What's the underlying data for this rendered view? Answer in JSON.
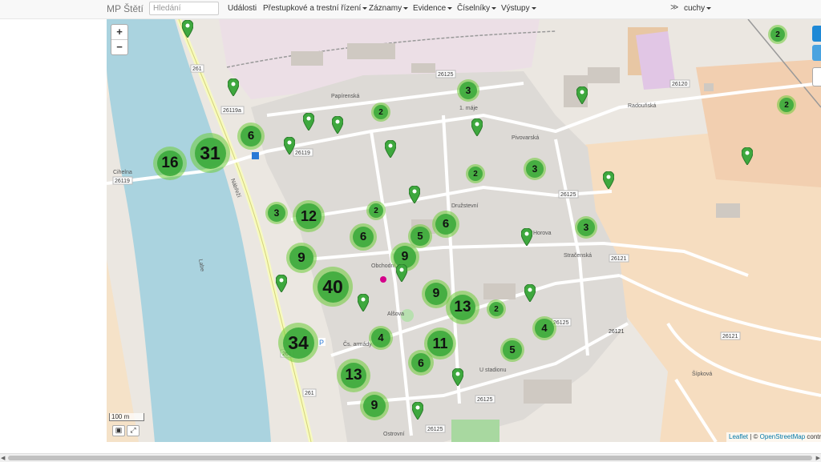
{
  "navbar": {
    "brand": "MP Štětí",
    "search_placeholder": "Hledání",
    "items": [
      {
        "label": "Události",
        "dropdown": false
      },
      {
        "label": "Přestupkové a trestní řízení",
        "dropdown": true
      },
      {
        "label": "Záznamy",
        "dropdown": true
      },
      {
        "label": "Evidence",
        "dropdown": true
      },
      {
        "label": "Číselníky",
        "dropdown": true
      },
      {
        "label": "Výstupy",
        "dropdown": true
      }
    ],
    "collapse_icon": "double-chevron-down-icon",
    "user": "cuchy"
  },
  "map": {
    "zoom_in": "+",
    "zoom_out": "−",
    "scale_label": "100 m",
    "attribution_leaflet": "Leaflet",
    "attribution_sep": " | © ",
    "attribution_osm": "OpenStreetMap",
    "attribution_tail": " contrib",
    "clusters": [
      "16",
      "31",
      "6",
      "2",
      "3",
      "2",
      "3",
      "12",
      "3",
      "2",
      "6",
      "6",
      "5",
      "9",
      "9",
      "40",
      "9",
      "13",
      "3",
      "2",
      "34",
      "4",
      "11",
      "13",
      "6",
      "5",
      "4",
      "9",
      "2",
      "2"
    ],
    "street_labels": [
      "Papírenská",
      "Cihelna",
      "1. máje",
      "Pivovarská",
      "Nábřeží",
      "Horova",
      "Družstevní",
      "Stračenská",
      "Obchodní",
      "Alšova",
      "Čs. armády",
      "Ostrovní",
      "U stadionu",
      "Radouňská",
      "Šípková",
      "Labe"
    ],
    "road_numbers": [
      "261",
      "261",
      "261",
      "26119",
      "26119",
      "26119a",
      "26125",
      "26125",
      "26125",
      "26125",
      "26125",
      "26120",
      "26121",
      "26121",
      "26121"
    ],
    "colors": {
      "water": "#aad3df",
      "cluster_outer": "#b5e28c",
      "cluster_inner": "#6ecc39",
      "pin": "#3ea83e",
      "leaflet_blue": "#0078a8"
    }
  }
}
